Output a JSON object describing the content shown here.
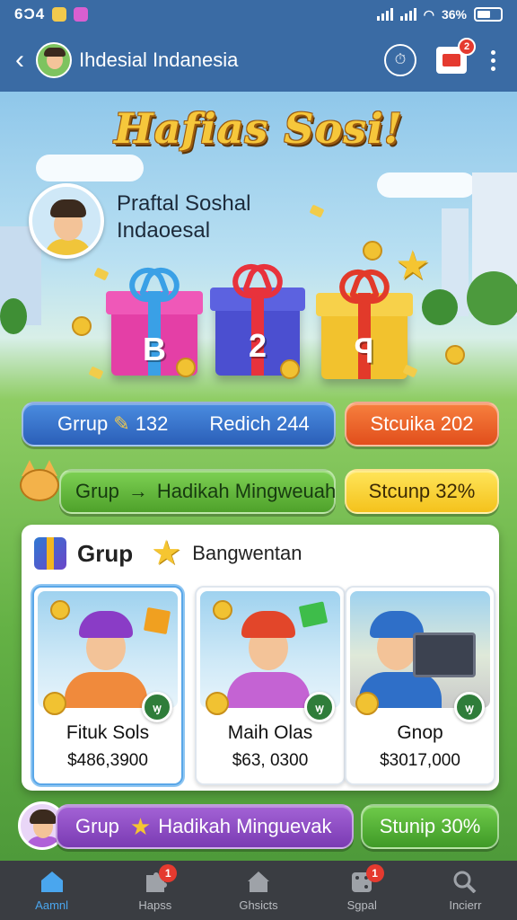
{
  "status_bar": {
    "time": "6Ɔ4",
    "network": "36%"
  },
  "app_bar": {
    "title": "Ihdesial Indanesia",
    "notification_count": "2"
  },
  "hero": {
    "title": "Hafias Sosi!",
    "profile_line1": "Praftal Soshal",
    "profile_line2": "Indaoesal"
  },
  "gifts": [
    {
      "glyph": "B",
      "color": "#e43fa6",
      "accent": "#3aa0e6"
    },
    {
      "glyph": "2",
      "color": "#4b4fd0",
      "accent": "#e8323c"
    },
    {
      "glyph": "ꟼ",
      "color": "#f2c22e",
      "accent": "#e23a2a"
    }
  ],
  "stats_row": {
    "group_label": "Grrup",
    "group_value": "132",
    "redeem_label": "Redich 244",
    "status_label": "Stcuika 202"
  },
  "reward_row": {
    "group_label": "Grup",
    "arrow": "→",
    "reward_label": "Hadikah Mingweuah",
    "status_label": "Stcunp 32%"
  },
  "panel": {
    "title": "Grup",
    "subtitle": "Bangwentan",
    "cards": [
      {
        "name": "Fituk Sols",
        "price": "$486,3900",
        "badge": "ꝡ",
        "hat_color": "#8a3cc6",
        "body_color": "#f08a3c"
      },
      {
        "name": "Maih Olas",
        "price": "$63, 0300",
        "badge": "ꝡ",
        "hat_color": "#e2462a",
        "body_color": "#c463d3"
      },
      {
        "name": "Gnop",
        "price": "$3017,000",
        "badge": "ꝡ",
        "hat_color": "#2f6fc8",
        "body_color": "#2f6fc8"
      }
    ]
  },
  "bottom_row": {
    "group_label": "Grup",
    "reward_label": "Hadikah Minguevak",
    "status_label": "Stunip 30%"
  },
  "bottom_nav": [
    {
      "label": "Aamnl",
      "icon": "home-icon",
      "active": true,
      "badge": ""
    },
    {
      "label": "Hapss",
      "icon": "puzzle-icon",
      "active": false,
      "badge": "1"
    },
    {
      "label": "Ghsicts",
      "icon": "house-icon",
      "active": false,
      "badge": ""
    },
    {
      "label": "Sgpal",
      "icon": "dice-icon",
      "active": false,
      "badge": "1"
    },
    {
      "label": "Incierr",
      "icon": "search-icon",
      "active": false,
      "badge": ""
    }
  ]
}
